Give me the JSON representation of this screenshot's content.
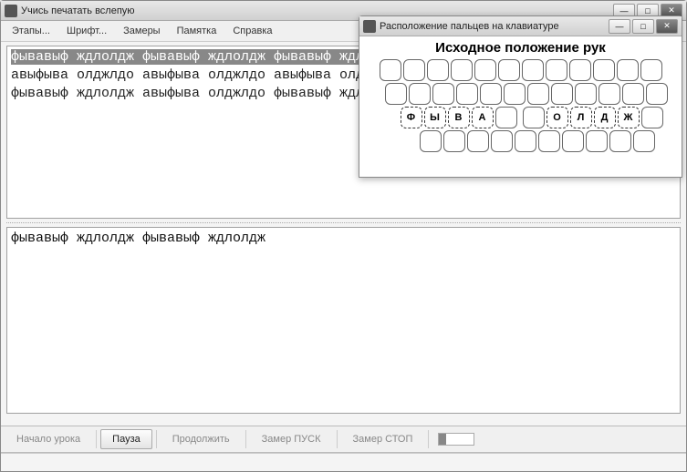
{
  "main_window": {
    "title": "Учись печатать вслепую"
  },
  "menu": {
    "etapy": "Этапы...",
    "shrift": "Шрифт...",
    "zamery": "Замеры",
    "pamyatka": "Памятка",
    "spravka": "Справка"
  },
  "lesson": {
    "line1": "фывавыф ждлолдж фывавыф ждлолдж фывавыф ждлолдж фывавыф ждлолдж",
    "line2": "авыфыва олджлдо авыфыва олджлдо авыфыва олджлдо авыфыва олджлдо",
    "line3": "фывавыф ждлолдж авыфыва олджлдо фывавыф ждлолдж авыфыва олджлдо"
  },
  "typed": {
    "text": "фывавыф ждлолдж фывавыф ждлолдж"
  },
  "bottombar": {
    "nachalo": "Начало урока",
    "pauza": "Пауза",
    "prodolzhit": "Продолжить",
    "zamer_pusk": "Замер ПУСК",
    "zamer_stop": "Замер СТОП"
  },
  "child_window": {
    "title": "Расположение пальцев на клавиатуре",
    "heading": "Исходное положение рук"
  },
  "home_keys": {
    "left": [
      "Ф",
      "Ы",
      "В",
      "А"
    ],
    "right": [
      "О",
      "Л",
      "Д",
      "Ж"
    ]
  }
}
